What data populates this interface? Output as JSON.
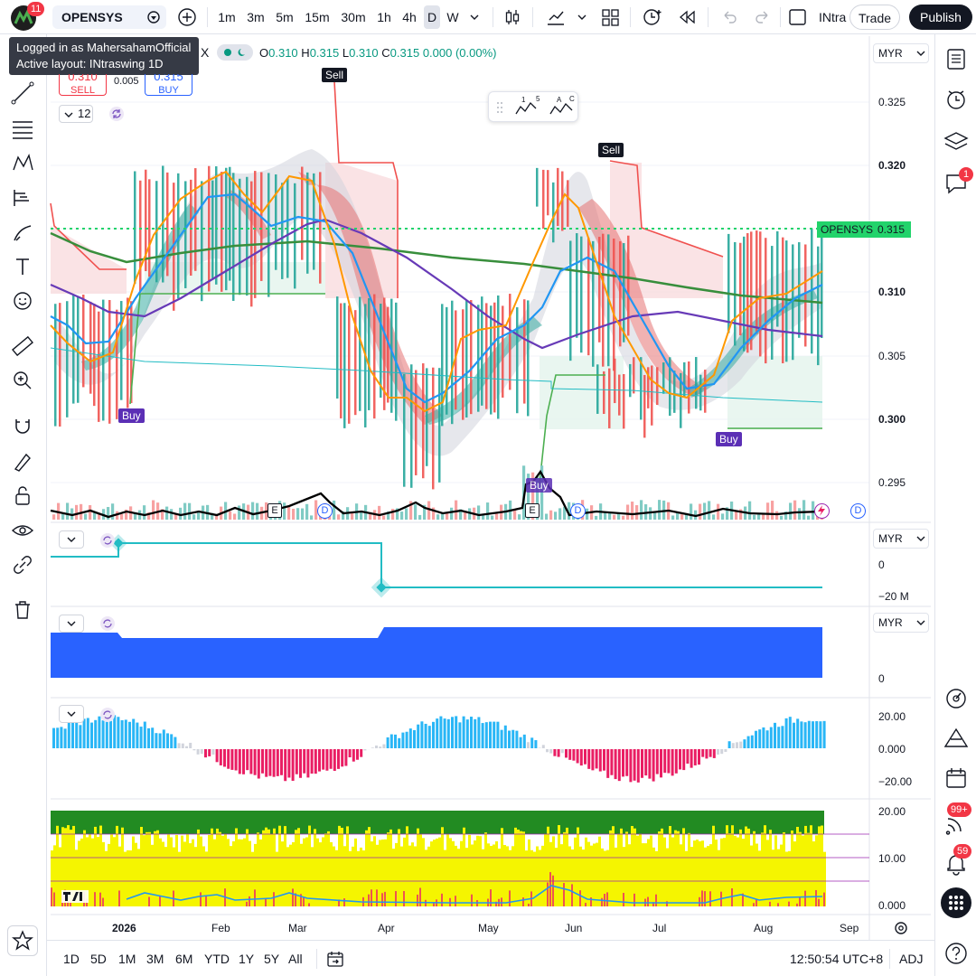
{
  "header": {
    "notif_count": "11",
    "symbol": "OPENSYS",
    "timeframes": [
      "1m",
      "3m",
      "5m",
      "15m",
      "30m",
      "1h",
      "4h",
      "D",
      "W"
    ],
    "layout_name_short": "INtra",
    "trade_label": "Trade",
    "publish_label": "Publish"
  },
  "tooltip": {
    "line1": "Logged in as MahersahamOfficial",
    "line2": "Active layout: INtraswing 1D"
  },
  "legend": {
    "prefix_x": "X",
    "o_label": "O",
    "o_value": "0.310",
    "h_label": "H",
    "h_value": "0.315",
    "l_label": "L",
    "l_value": "0.310",
    "c_label": "C",
    "c_value": "0.315",
    "change": "0.000 (0.00%)",
    "sell_price": "0.310",
    "sell_label": "SELL",
    "spread": "0.005",
    "buy_price": "0.315",
    "buy_label": "BUY",
    "indicator_count": "12"
  },
  "price_axis": {
    "currency": "MYR",
    "ticks": [
      "0.325",
      "0.320",
      "0.310",
      "0.305",
      "0.300",
      "0.295"
    ],
    "bold_ticks": [
      "0.320",
      "0.310",
      "0.300"
    ],
    "last_price_label": "OPENSYS",
    "last_price": "0.315"
  },
  "signals": {
    "sell": "Sell",
    "buy": "Buy"
  },
  "events": {
    "earnings": "E",
    "dividend": "D"
  },
  "pane2": {
    "currency": "MYR",
    "ticks": [
      "0",
      "−20 M"
    ]
  },
  "pane3": {
    "currency": "MYR",
    "ticks": [
      "0"
    ]
  },
  "pane4": {
    "ticks": [
      "20.00",
      "0.000",
      "−20.00"
    ]
  },
  "pane5": {
    "ticks": [
      "20.00",
      "10.00",
      "0.000"
    ]
  },
  "time_axis": {
    "ticks": [
      "2026",
      "Feb",
      "Mar",
      "Apr",
      "May",
      "Jun",
      "Jul",
      "Aug",
      "Sep"
    ]
  },
  "bottom": {
    "ranges": [
      "1D",
      "5D",
      "1M",
      "3M",
      "6M",
      "YTD",
      "1Y",
      "5Y",
      "All"
    ],
    "clock": "12:50:54 UTC+8",
    "adj": "ADJ"
  },
  "right_badges": {
    "chat": "1",
    "ideas": "99+",
    "alerts": "59"
  },
  "colors": {
    "accent": "#2962ff",
    "up": "#089981",
    "down": "#f23645",
    "buy_label": "#5b2fb5",
    "last_price": "#22d36b"
  }
}
